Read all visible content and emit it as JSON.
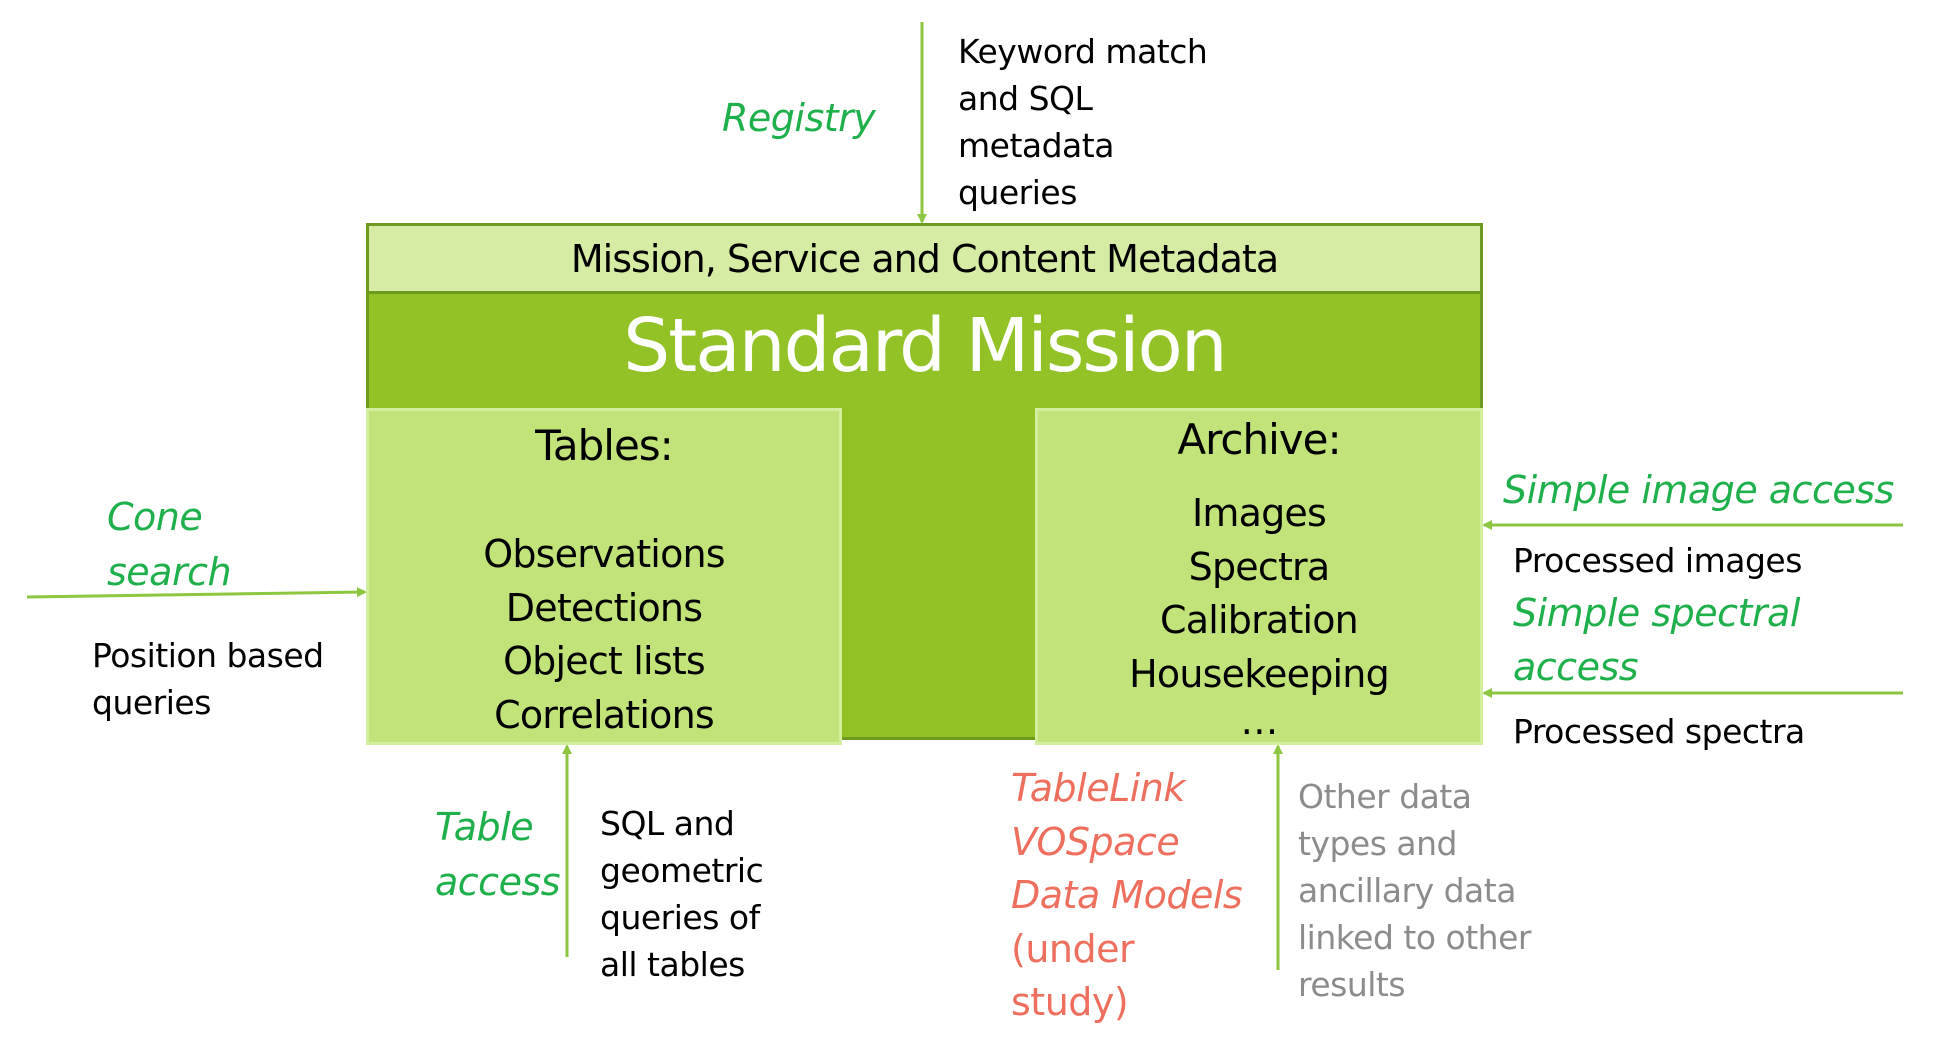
{
  "diagram": {
    "main_box": {
      "metadata_band_label": "Mission, Service and Content Metadata",
      "title": "Standard Mission"
    },
    "tables_box": {
      "heading": "Tables:",
      "items": [
        "Observations",
        "Detections",
        "Object lists",
        "Correlations"
      ]
    },
    "archive_box": {
      "heading": "Archive:",
      "items": [
        "Images",
        "Spectra",
        "Calibration",
        "Housekeeping",
        "…"
      ]
    },
    "interfaces": {
      "registry": {
        "label": "Registry",
        "description": [
          "Keyword match",
          "and SQL",
          "metadata",
          "queries"
        ]
      },
      "cone_search": {
        "label": [
          "Cone",
          "search"
        ],
        "description": [
          "Position based",
          "queries"
        ]
      },
      "table_access": {
        "label": [
          "Table",
          "access"
        ],
        "description": [
          "SQL and",
          "geometric",
          "queries of",
          "all tables"
        ]
      },
      "simple_image_access": {
        "label": "Simple image access",
        "description": "Processed images"
      },
      "simple_spectral_access": {
        "label": [
          "Simple spectral",
          "access"
        ],
        "description": "Processed spectra"
      },
      "under_study": {
        "label": [
          "TableLink",
          "VOSpace",
          "Data Models",
          "(under",
          "study)"
        ],
        "description": [
          "Other data",
          "types and",
          "ancillary data",
          "linked to other",
          "results"
        ]
      }
    },
    "colors": {
      "main_green": "#92C226",
      "band_light_green": "#D6ECA5",
      "inner_box_green": "#C2E37A",
      "border_dark_green": "#6E9A1E",
      "arrow_green": "#8DC63F",
      "interface_label_green": "#1DB04B",
      "under_study_red": "#EE6F5E",
      "secondary_gray": "#8C8C8C"
    }
  }
}
